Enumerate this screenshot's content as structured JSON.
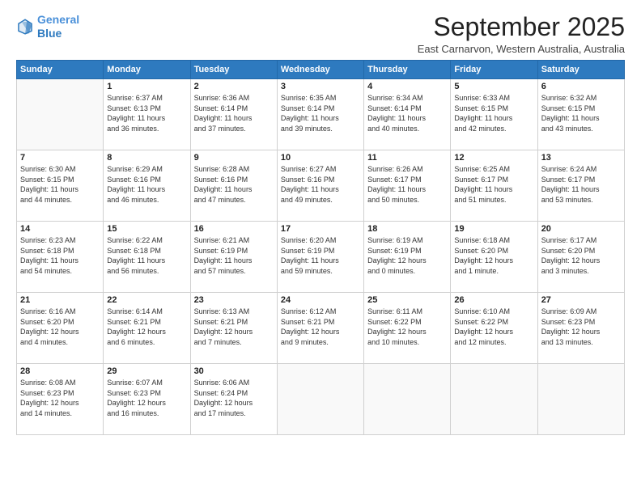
{
  "logo": {
    "line1": "General",
    "line2": "Blue"
  },
  "title": "September 2025",
  "subtitle": "East Carnarvon, Western Australia, Australia",
  "days": [
    "Sunday",
    "Monday",
    "Tuesday",
    "Wednesday",
    "Thursday",
    "Friday",
    "Saturday"
  ],
  "weeks": [
    [
      {
        "day": "",
        "content": ""
      },
      {
        "day": "1",
        "content": "Sunrise: 6:37 AM\nSunset: 6:13 PM\nDaylight: 11 hours\nand 36 minutes."
      },
      {
        "day": "2",
        "content": "Sunrise: 6:36 AM\nSunset: 6:14 PM\nDaylight: 11 hours\nand 37 minutes."
      },
      {
        "day": "3",
        "content": "Sunrise: 6:35 AM\nSunset: 6:14 PM\nDaylight: 11 hours\nand 39 minutes."
      },
      {
        "day": "4",
        "content": "Sunrise: 6:34 AM\nSunset: 6:14 PM\nDaylight: 11 hours\nand 40 minutes."
      },
      {
        "day": "5",
        "content": "Sunrise: 6:33 AM\nSunset: 6:15 PM\nDaylight: 11 hours\nand 42 minutes."
      },
      {
        "day": "6",
        "content": "Sunrise: 6:32 AM\nSunset: 6:15 PM\nDaylight: 11 hours\nand 43 minutes."
      }
    ],
    [
      {
        "day": "7",
        "content": "Sunrise: 6:30 AM\nSunset: 6:15 PM\nDaylight: 11 hours\nand 44 minutes."
      },
      {
        "day": "8",
        "content": "Sunrise: 6:29 AM\nSunset: 6:16 PM\nDaylight: 11 hours\nand 46 minutes."
      },
      {
        "day": "9",
        "content": "Sunrise: 6:28 AM\nSunset: 6:16 PM\nDaylight: 11 hours\nand 47 minutes."
      },
      {
        "day": "10",
        "content": "Sunrise: 6:27 AM\nSunset: 6:16 PM\nDaylight: 11 hours\nand 49 minutes."
      },
      {
        "day": "11",
        "content": "Sunrise: 6:26 AM\nSunset: 6:17 PM\nDaylight: 11 hours\nand 50 minutes."
      },
      {
        "day": "12",
        "content": "Sunrise: 6:25 AM\nSunset: 6:17 PM\nDaylight: 11 hours\nand 51 minutes."
      },
      {
        "day": "13",
        "content": "Sunrise: 6:24 AM\nSunset: 6:17 PM\nDaylight: 11 hours\nand 53 minutes."
      }
    ],
    [
      {
        "day": "14",
        "content": "Sunrise: 6:23 AM\nSunset: 6:18 PM\nDaylight: 11 hours\nand 54 minutes."
      },
      {
        "day": "15",
        "content": "Sunrise: 6:22 AM\nSunset: 6:18 PM\nDaylight: 11 hours\nand 56 minutes."
      },
      {
        "day": "16",
        "content": "Sunrise: 6:21 AM\nSunset: 6:19 PM\nDaylight: 11 hours\nand 57 minutes."
      },
      {
        "day": "17",
        "content": "Sunrise: 6:20 AM\nSunset: 6:19 PM\nDaylight: 11 hours\nand 59 minutes."
      },
      {
        "day": "18",
        "content": "Sunrise: 6:19 AM\nSunset: 6:19 PM\nDaylight: 12 hours\nand 0 minutes."
      },
      {
        "day": "19",
        "content": "Sunrise: 6:18 AM\nSunset: 6:20 PM\nDaylight: 12 hours\nand 1 minute."
      },
      {
        "day": "20",
        "content": "Sunrise: 6:17 AM\nSunset: 6:20 PM\nDaylight: 12 hours\nand 3 minutes."
      }
    ],
    [
      {
        "day": "21",
        "content": "Sunrise: 6:16 AM\nSunset: 6:20 PM\nDaylight: 12 hours\nand 4 minutes."
      },
      {
        "day": "22",
        "content": "Sunrise: 6:14 AM\nSunset: 6:21 PM\nDaylight: 12 hours\nand 6 minutes."
      },
      {
        "day": "23",
        "content": "Sunrise: 6:13 AM\nSunset: 6:21 PM\nDaylight: 12 hours\nand 7 minutes."
      },
      {
        "day": "24",
        "content": "Sunrise: 6:12 AM\nSunset: 6:21 PM\nDaylight: 12 hours\nand 9 minutes."
      },
      {
        "day": "25",
        "content": "Sunrise: 6:11 AM\nSunset: 6:22 PM\nDaylight: 12 hours\nand 10 minutes."
      },
      {
        "day": "26",
        "content": "Sunrise: 6:10 AM\nSunset: 6:22 PM\nDaylight: 12 hours\nand 12 minutes."
      },
      {
        "day": "27",
        "content": "Sunrise: 6:09 AM\nSunset: 6:23 PM\nDaylight: 12 hours\nand 13 minutes."
      }
    ],
    [
      {
        "day": "28",
        "content": "Sunrise: 6:08 AM\nSunset: 6:23 PM\nDaylight: 12 hours\nand 14 minutes."
      },
      {
        "day": "29",
        "content": "Sunrise: 6:07 AM\nSunset: 6:23 PM\nDaylight: 12 hours\nand 16 minutes."
      },
      {
        "day": "30",
        "content": "Sunrise: 6:06 AM\nSunset: 6:24 PM\nDaylight: 12 hours\nand 17 minutes."
      },
      {
        "day": "",
        "content": ""
      },
      {
        "day": "",
        "content": ""
      },
      {
        "day": "",
        "content": ""
      },
      {
        "day": "",
        "content": ""
      }
    ]
  ]
}
